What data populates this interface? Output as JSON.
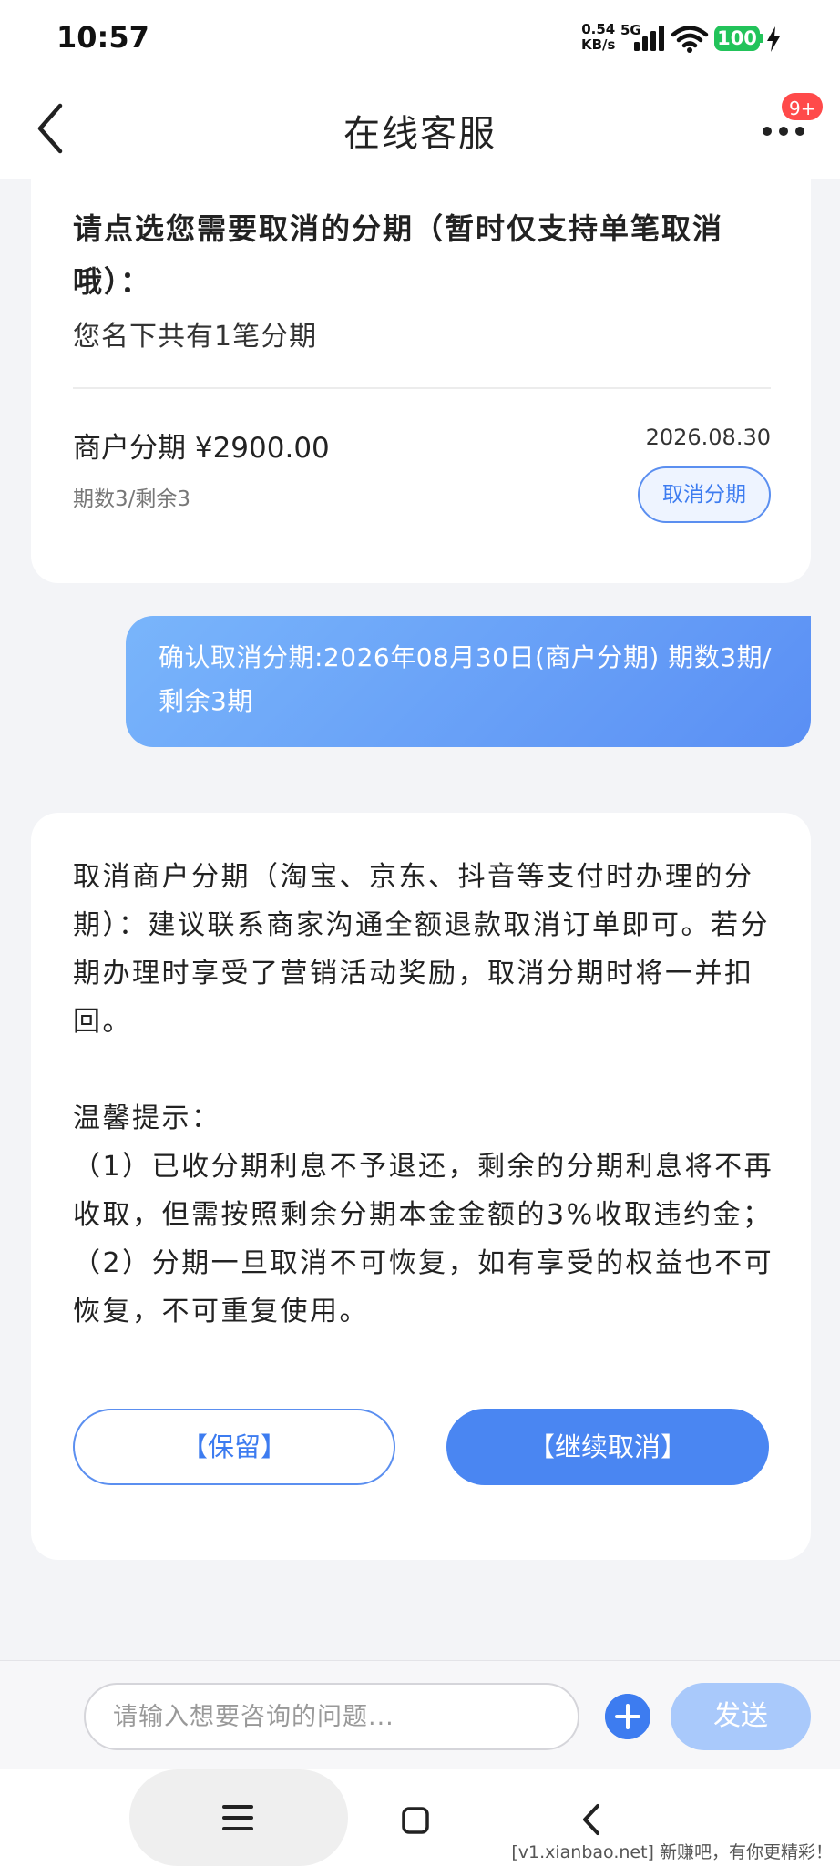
{
  "status_bar": {
    "time": "10:57",
    "net_speed_value": "0.54",
    "net_speed_unit": "KB/s",
    "network": "5G",
    "battery": "100"
  },
  "header": {
    "title": "在线客服",
    "badge": "9+"
  },
  "installment_card": {
    "title": "请点选您需要取消的分期（暂时仅支持单笔取消哦）：",
    "subtitle": "您名下共有1笔分期",
    "item": {
      "name": "商户分期 ¥2900.00",
      "date": "2026.08.30",
      "count": "期数3/剩余3",
      "cancel_label": "取消分期"
    }
  },
  "user_message": "确认取消分期:2026年08月30日(商户分期) 期数3期/剩余3期",
  "info_card": {
    "paragraph": "取消商户分期（淘宝、京东、抖音等支付时办理的分期）：建议联系商家沟通全额退款取消订单即可。若分期办理时享受了营销活动奖励，取消分期时将一并扣回。",
    "tips_title": "温馨提示：",
    "tip1": "（1）已收分期利息不予退还，剩余的分期利息将不再收取，但需按照剩余分期本金金额的3%收取违约金；",
    "tip2": "（2）分期一旦取消不可恢复，如有享受的权益也不可恢复，不可重复使用。",
    "keep_label": "【保留】",
    "continue_label": "【继续取消】"
  },
  "input_bar": {
    "placeholder": "请输入想要咨询的问题...",
    "send_label": "发送"
  },
  "watermark": "[v1.xianbao.net] 新赚吧，有你更精彩！",
  "colors": {
    "accent": "#4a86f2",
    "bubble_start": "#79b5fb",
    "bubble_end": "#5a8ff4",
    "badge": "#ff4a4a",
    "battery": "#22c35a"
  }
}
